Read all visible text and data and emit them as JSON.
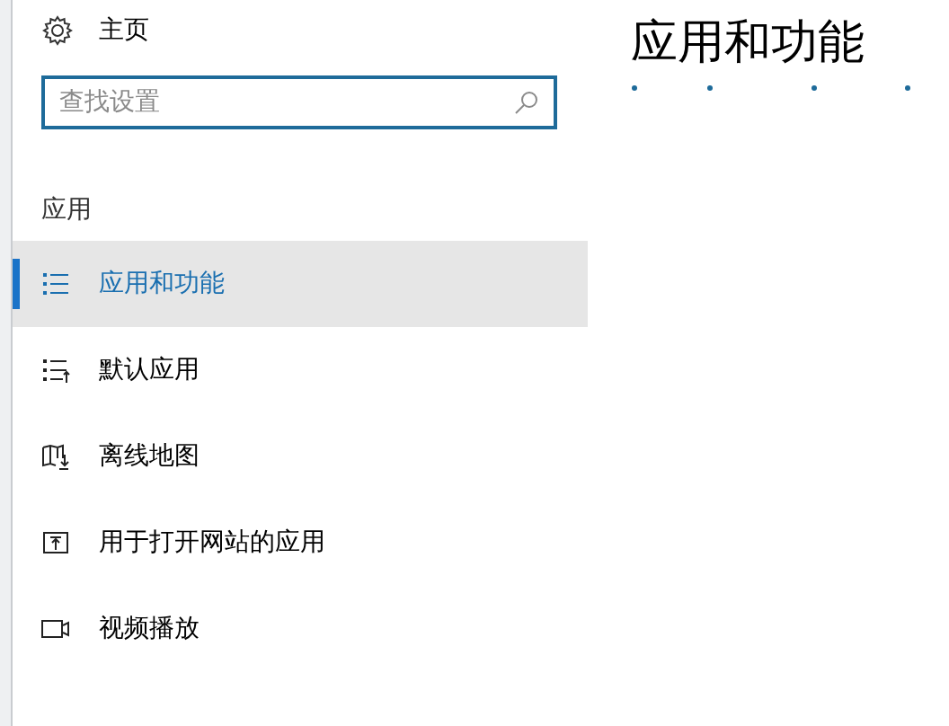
{
  "home": {
    "label": "主页"
  },
  "search": {
    "placeholder": "查找设置"
  },
  "section": "应用",
  "nav_items": [
    {
      "label": "应用和功能",
      "kind": "list",
      "selected": true
    },
    {
      "label": "默认应用",
      "kind": "default-list",
      "selected": false
    },
    {
      "label": "离线地图",
      "kind": "map",
      "selected": false
    },
    {
      "label": "用于打开网站的应用",
      "kind": "open-box",
      "selected": false
    },
    {
      "label": "视频播放",
      "kind": "video",
      "selected": false
    }
  ],
  "page_title": "应用和功能"
}
